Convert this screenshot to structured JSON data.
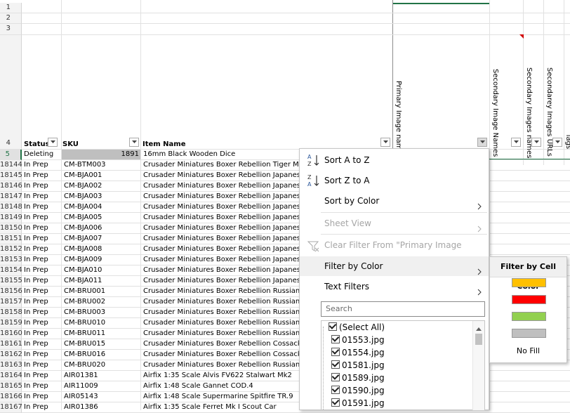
{
  "spreadsheet": {
    "header_row_number": "4",
    "active_row_number": "5",
    "top_row_numbers": [
      "1",
      "2",
      "3"
    ],
    "columns": {
      "status": "Status",
      "sku": "SKU",
      "item_name": "Item Name",
      "primary_image": "Primary Image name",
      "secondary_image_names": "Secondary Image Names",
      "secondary_images_names": "Secondary Images names",
      "secondarey_images_urls": "Secondarey Images URLs",
      "tags_partial": "Tags"
    },
    "first_row": {
      "status": "Deleting",
      "sku_number": "1891",
      "item": "16mm Black Wooden Dice"
    },
    "rows": [
      {
        "num": "18144",
        "status": "In Prep",
        "sku": "CM-BTM003",
        "item": "Crusader Miniatures Boxer Rebellion Tiger Men"
      },
      {
        "num": "18145",
        "status": "In Prep",
        "sku": "CM-BJA001",
        "item": "Crusader Miniatures Boxer Rebellion Japanese"
      },
      {
        "num": "18146",
        "status": "In Prep",
        "sku": "CM-BJA002",
        "item": "Crusader Miniatures Boxer Rebellion Japanese"
      },
      {
        "num": "18147",
        "status": "In Prep",
        "sku": "CM-BJA003",
        "item": "Crusader Miniatures Boxer Rebellion Japanese"
      },
      {
        "num": "18148",
        "status": "In Prep",
        "sku": "CM-BJA004",
        "item": "Crusader Miniatures Boxer Rebellion Japanese"
      },
      {
        "num": "18149",
        "status": "In Prep",
        "sku": "CM-BJA005",
        "item": "Crusader Miniatures Boxer Rebellion Japanese"
      },
      {
        "num": "18150",
        "status": "In Prep",
        "sku": "CM-BJA006",
        "item": "Crusader Miniatures Boxer Rebellion Japanese"
      },
      {
        "num": "18151",
        "status": "In Prep",
        "sku": "CM-BJA007",
        "item": "Crusader Miniatures Boxer Rebellion Japanese"
      },
      {
        "num": "18152",
        "status": "In Prep",
        "sku": "CM-BJA008",
        "item": "Crusader Miniatures Boxer Rebellion Japanese"
      },
      {
        "num": "18153",
        "status": "In Prep",
        "sku": "CM-BJA009",
        "item": "Crusader Miniatures Boxer Rebellion Japanese"
      },
      {
        "num": "18154",
        "status": "In Prep",
        "sku": "CM-BJA010",
        "item": "Crusader Miniatures Boxer Rebellion Japanese"
      },
      {
        "num": "18155",
        "status": "In Prep",
        "sku": "CM-BJA011",
        "item": "Crusader Miniatures Boxer Rebellion Japanese"
      },
      {
        "num": "18156",
        "status": "In Prep",
        "sku": "CM-BRU001",
        "item": "Crusader Miniatures Boxer Rebellion Russian In"
      },
      {
        "num": "18157",
        "status": "In Prep",
        "sku": "CM-BRU002",
        "item": "Crusader Miniatures Boxer Rebellion Russian In"
      },
      {
        "num": "18158",
        "status": "In Prep",
        "sku": "CM-BRU003",
        "item": "Crusader Miniatures Boxer Rebellion Russian In"
      },
      {
        "num": "18159",
        "status": "In Prep",
        "sku": "CM-BRU010",
        "item": "Crusader Miniatures Boxer Rebellion Russian D"
      },
      {
        "num": "18160",
        "status": "In Prep",
        "sku": "CM-BRU011",
        "item": "Crusader Miniatures Boxer Rebellion Russian D"
      },
      {
        "num": "18161",
        "status": "In Prep",
        "sku": "CM-BRU015",
        "item": "Crusader Miniatures Boxer Rebellion Cossacks"
      },
      {
        "num": "18162",
        "status": "In Prep",
        "sku": "CM-BRU016",
        "item": "Crusader Miniatures Boxer Rebellion Cossack C"
      },
      {
        "num": "18163",
        "status": "In Prep",
        "sku": "CM-BRU020",
        "item": "Crusader Miniatures Boxer Rebellion Russian G"
      },
      {
        "num": "18164",
        "status": "In Prep",
        "sku": "AIR01381",
        "item": "Airfix 1:35 Scale Alvis FV622 Stalwart Mk2"
      },
      {
        "num": "18165",
        "status": "In Prep",
        "sku": "AIR11009",
        "item": "Airfix 1:48 Scale Gannet COD.4"
      },
      {
        "num": "18166",
        "status": "In Prep",
        "sku": "AIR05143",
        "item": "Airfix 1:48 Scale Supermarine Spitfire TR.9"
      },
      {
        "num": "18167",
        "status": "In Prep",
        "sku": "AIR01386",
        "item": "Airfix 1:35 Scale Ferret Mk I Scout Car"
      }
    ]
  },
  "filter_menu": {
    "sort_az": "Sort A to Z",
    "sort_za": "Sort Z to A",
    "sort_by_color": "Sort by Color",
    "sheet_view": "Sheet View",
    "clear_filter": "Clear Filter From \"Primary Image name\"",
    "filter_by_color": "Filter by Color",
    "text_filters": "Text Filters",
    "search_placeholder": "Search",
    "values": [
      "(Select All)",
      "01553.jpg",
      "01554.jpg",
      "01581.jpg",
      "01589.jpg",
      "01590.jpg",
      "01591.jpg"
    ]
  },
  "color_submenu": {
    "title": "Filter by Cell Color",
    "swatches": [
      "#ffc000",
      "#ff0000",
      "#92d050",
      "#bfbfbf"
    ],
    "no_fill": "No Fill"
  },
  "theme": {
    "excel_green": "#217346",
    "selected_cell_gray": "#bfbfbf"
  }
}
